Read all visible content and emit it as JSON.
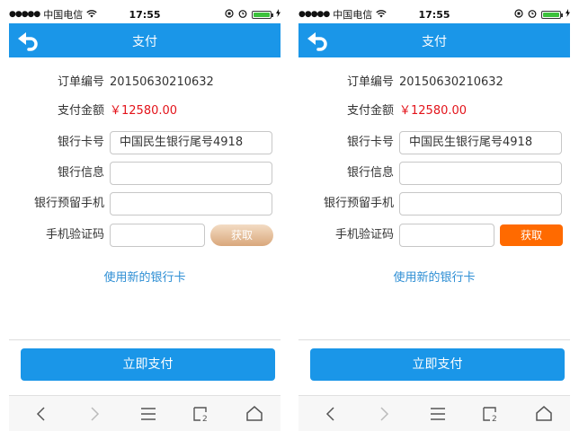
{
  "colors": {
    "accent": "#1a96e8",
    "amount": "#e3141b",
    "link": "#2d8ed4",
    "get_code_left": "#d9a77b",
    "get_code_right": "#ff6a00"
  },
  "status": {
    "carrier": "中国电信",
    "time": "17:55"
  },
  "nav": {
    "title": "支付",
    "back_icon": "back-arrow-icon"
  },
  "order": {
    "id_label": "订单编号",
    "id_value": "20150630210632",
    "amount_label": "支付金额",
    "amount_value": "￥12580.00"
  },
  "form": {
    "card_label": "银行卡号",
    "card_value": "中国民生银行尾号4918",
    "bank_info_label": "银行信息",
    "bank_info_value": "",
    "phone_label": "银行预留手机",
    "phone_value": "",
    "sms_label": "手机验证码",
    "sms_value": "",
    "get_code_label": "获取"
  },
  "new_card_link": "使用新的银行卡",
  "pay_button": "立即支付",
  "toolbar": {
    "icons": [
      "back-icon",
      "forward-icon",
      "menu-icon",
      "tabs-icon",
      "home-icon"
    ],
    "tabs_count": "2"
  }
}
